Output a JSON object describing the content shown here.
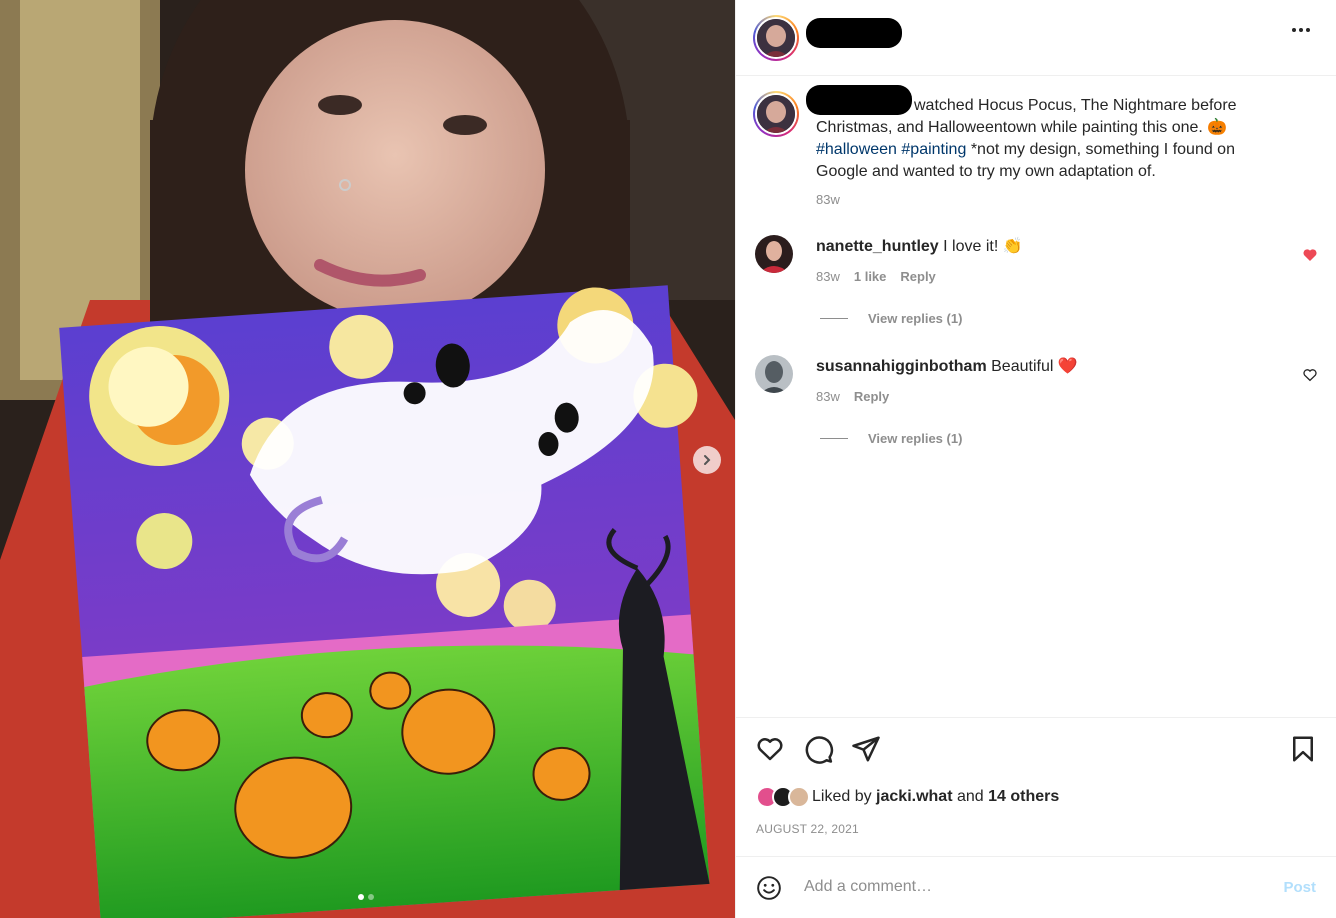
{
  "post": {
    "image_alt_icon": "photo",
    "carousel": {
      "slides": 2,
      "active": 1
    }
  },
  "header": {
    "more_icon": "more-horizontal-icon"
  },
  "caption": {
    "text_1": "watched Hocus Pocus, The Nightmare before Christmas, and Halloweentown while painting this one. 🎃",
    "tag_1": "#halloween",
    "tag_2": "#painting",
    "text_2": "*not my design, something I found on Google and wanted to try my own adaptation of.",
    "time": "83w"
  },
  "comments": [
    {
      "username": "nanette_huntley",
      "text": "I love it! 👏",
      "time": "83w",
      "likes": "1 like",
      "reply": "Reply",
      "view_replies": "View replies (1)",
      "liked": true
    },
    {
      "username": "susannahigginbotham",
      "text": "Beautiful ❤️",
      "time": "83w",
      "reply": "Reply",
      "view_replies": "View replies (1)",
      "liked": false
    }
  ],
  "actions": {
    "icons": [
      "heart-icon",
      "comment-icon",
      "share-icon",
      "bookmark-icon"
    ]
  },
  "likes": {
    "prefix": "Liked by",
    "user": "jacki.what",
    "middle": "and",
    "others": "14 others"
  },
  "date": "AUGUST 22, 2021",
  "add_comment": {
    "placeholder": "Add a comment…",
    "post_label": "Post"
  },
  "colors": {
    "heart_red": "#ed4956",
    "hashtag": "#00376b",
    "muted": "#8e8e8e",
    "post_disabled": "#b2dffc"
  }
}
